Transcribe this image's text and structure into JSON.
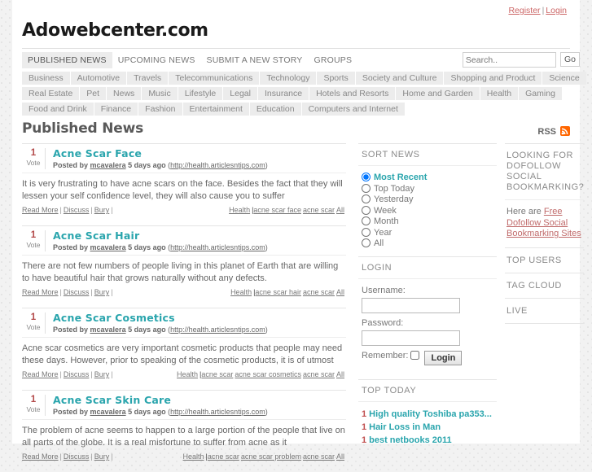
{
  "topbar": {
    "register": "Register",
    "separator": "|",
    "login": "Login"
  },
  "site": {
    "title": "Adowebcenter.com"
  },
  "nav": {
    "items": [
      {
        "label": "PUBLISHED NEWS",
        "active": true
      },
      {
        "label": "UPCOMING NEWS",
        "active": false
      },
      {
        "label": "SUBMIT A NEW STORY",
        "active": false
      },
      {
        "label": "GROUPS",
        "active": false
      }
    ],
    "search": {
      "placeholder": "Search..",
      "value": "",
      "go_label": "Go"
    }
  },
  "categories": {
    "row1": [
      "Business",
      "Automotive",
      "Travels",
      "Telecommunications",
      "Technology",
      "Sports",
      "Society and Culture",
      "Shopping and Product",
      "Science"
    ],
    "row2": [
      "Real Estate",
      "Pet",
      "News",
      "Music",
      "Lifestyle",
      "Legal",
      "Insurance",
      "Hotels and Resorts",
      "Home and Garden",
      "Health",
      "Gaming"
    ],
    "row3": [
      "Food and Drink",
      "Finance",
      "Fashion",
      "Entertainment",
      "Education",
      "Computers and Internet"
    ]
  },
  "page": {
    "heading": "Published News",
    "rss_label": "RSS",
    "rss_icon": "rss-icon"
  },
  "stories": [
    {
      "votes": "1",
      "vote_label": "Vote",
      "title": "Acne Scar Face",
      "posted_prefix": "Posted by",
      "author": "mcavalera",
      "time": "5 days ago",
      "source_open": "(",
      "source": "http://health.articlesntips.com",
      "source_close": ")",
      "description": "It is very frustrating to have acne scars on the face. Besides the fact that they will lessen your self confidence level, they will also cause you to suffer",
      "actions": [
        "Read More",
        "Discuss",
        "Bury"
      ],
      "category": "Health",
      "tags": [
        "acne scar face",
        "acne scar"
      ],
      "all_label": "All"
    },
    {
      "votes": "1",
      "vote_label": "Vote",
      "title": "Acne Scar Hair",
      "posted_prefix": "Posted by",
      "author": "mcavalera",
      "time": "5 days ago",
      "source_open": "(",
      "source": "http://health.articlesntips.com",
      "source_close": ")",
      "description": "There are not few numbers of people living in this planet of Earth that are willing to have beautiful hair that grows naturally without any defects.",
      "actions": [
        "Read More",
        "Discuss",
        "Bury"
      ],
      "category": "Health",
      "tags": [
        "acne scar hair",
        "acne scar"
      ],
      "all_label": "All"
    },
    {
      "votes": "1",
      "vote_label": "Vote",
      "title": "Acne Scar Cosmetics",
      "posted_prefix": "Posted by",
      "author": "mcavalera",
      "time": "5 days ago",
      "source_open": "(",
      "source": "http://health.articlesntips.com",
      "source_close": ")",
      "description": "Acne scar cosmetics are very important cosmetic products that people may need these days. However, prior to speaking of the cosmetic products, it is of utmost",
      "actions": [
        "Read More",
        "Discuss",
        "Bury"
      ],
      "category": "Health",
      "tags": [
        "acne scar",
        "acne scar cosmetics",
        "acne scar"
      ],
      "all_label": "All"
    },
    {
      "votes": "1",
      "vote_label": "Vote",
      "title": "Acne Scar Skin Care",
      "posted_prefix": "Posted by",
      "author": "mcavalera",
      "time": "5 days ago",
      "source_open": "(",
      "source": "http://health.articlesntips.com",
      "source_close": ")",
      "description": "The problem of acne seems to happen to a large portion of the people that live on all parts of the globe. It is a real misfortune to suffer from acne as it",
      "actions": [
        "Read More",
        "Discuss",
        "Bury"
      ],
      "category": "Health",
      "tags": [
        "acne scar",
        "acne scar problem",
        "acne scar"
      ],
      "all_label": "All"
    }
  ],
  "sort_news": {
    "heading": "SORT NEWS",
    "options": [
      {
        "label": "Most Recent",
        "selected": true
      },
      {
        "label": "Top Today",
        "selected": false
      },
      {
        "label": "Yesterday",
        "selected": false
      },
      {
        "label": "Week",
        "selected": false
      },
      {
        "label": "Month",
        "selected": false
      },
      {
        "label": "Year",
        "selected": false
      },
      {
        "label": "All",
        "selected": false
      }
    ]
  },
  "login_box": {
    "heading": "LOGIN",
    "username_label": "Username:",
    "username_value": "",
    "password_label": "Password:",
    "password_value": "",
    "remember_label": "Remember:",
    "remember_checked": false,
    "button_label": "Login"
  },
  "top_today": {
    "heading": "TOP TODAY",
    "items": [
      {
        "rank": "1",
        "title": "High quality Toshiba pa353..."
      },
      {
        "rank": "1",
        "title": "Hair Loss in Man"
      },
      {
        "rank": "1",
        "title": "best netbooks 2011"
      }
    ]
  },
  "right_column": {
    "promo_heading": "LOOKING FOR DOFOLLOW SOCIAL BOOKMARKING?",
    "promo_prefix": "Here are ",
    "promo_link": "Free Dofollow Social Bookmarking Sites",
    "top_users": "TOP USERS",
    "tag_cloud": "TAG CLOUD",
    "live": "LIVE"
  },
  "colors": {
    "accent_teal": "#2aa5ad",
    "link_red": "#c06a6a",
    "vote_red": "#b34a4a",
    "rss_orange": "#ff6600"
  }
}
